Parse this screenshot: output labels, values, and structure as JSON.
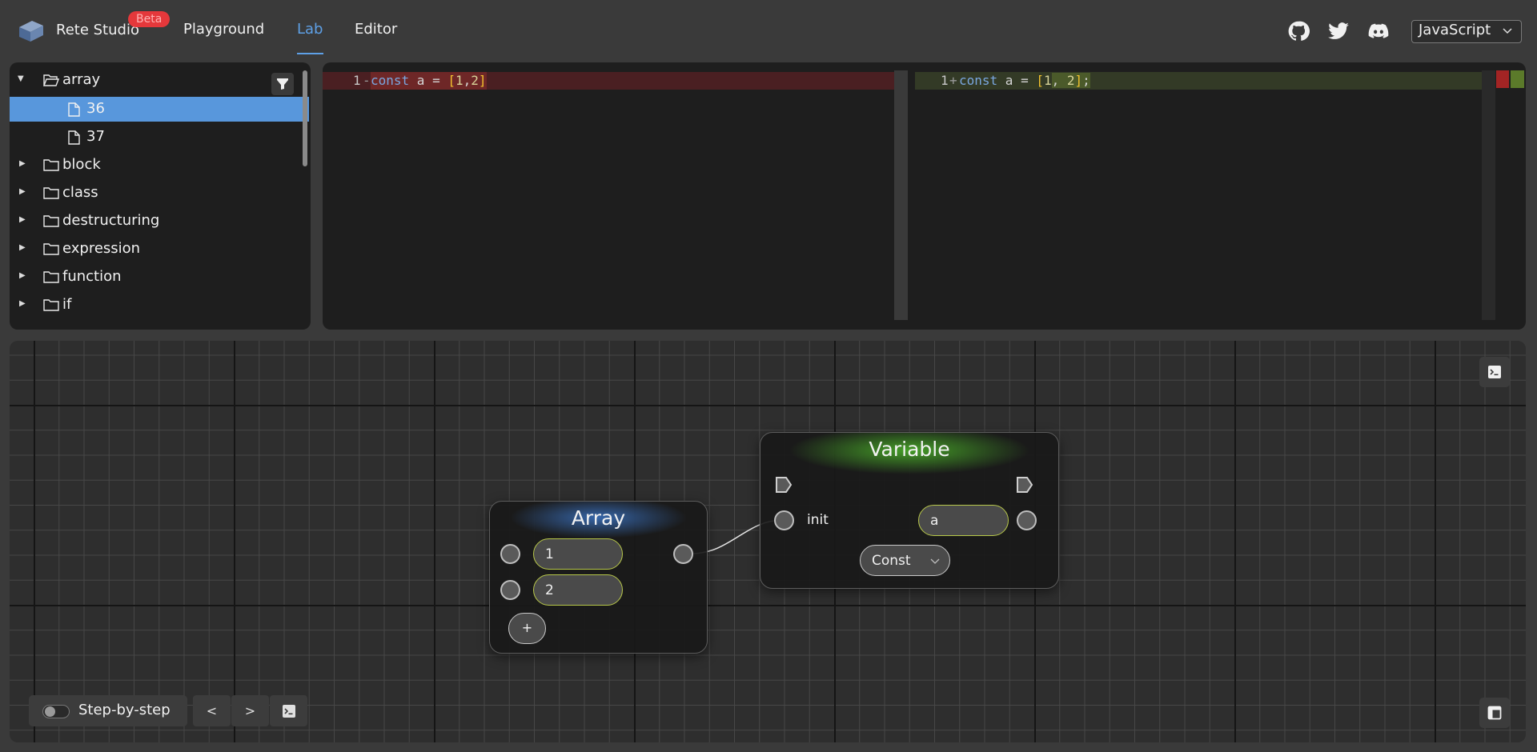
{
  "header": {
    "brand": "Rete Studio",
    "beta": "Beta",
    "nav": [
      {
        "label": "Playground",
        "active": false
      },
      {
        "label": "Lab",
        "active": true
      },
      {
        "label": "Editor",
        "active": false
      }
    ],
    "social_icons": [
      "github-icon",
      "twitter-icon",
      "discord-icon"
    ],
    "language": "JavaScript"
  },
  "tree": {
    "items": [
      {
        "label": "array",
        "type": "folder",
        "expanded": true
      },
      {
        "label": "36",
        "type": "file",
        "selected": true
      },
      {
        "label": "37",
        "type": "file",
        "selected": false
      },
      {
        "label": "block",
        "type": "folder",
        "expanded": false
      },
      {
        "label": "class",
        "type": "folder",
        "expanded": false
      },
      {
        "label": "destructuring",
        "type": "folder",
        "expanded": false
      },
      {
        "label": "expression",
        "type": "folder",
        "expanded": false
      },
      {
        "label": "function",
        "type": "folder",
        "expanded": false
      },
      {
        "label": "if",
        "type": "folder",
        "expanded": false
      }
    ]
  },
  "diff": {
    "left": {
      "line": "1",
      "marker": "-",
      "code": "const a = [1,2]"
    },
    "right": {
      "line": "1",
      "marker": "+",
      "code": "const a = [1, 2];"
    }
  },
  "nodes": {
    "array": {
      "title": "Array",
      "items": [
        "1",
        "2"
      ],
      "add_label": "+"
    },
    "variable": {
      "title": "Variable",
      "init_label": "init",
      "name_value": "a",
      "kind": "Const"
    }
  },
  "toolbar": {
    "step_label": "Step-by-step",
    "prev_label": "<",
    "next_label": ">"
  },
  "colors": {
    "accent": "#5ea0e6",
    "beta": "#e5383b",
    "selected_row": "#5897dc",
    "array_glow": "#3f7fd9",
    "variable_glow": "#4fbf2a"
  }
}
